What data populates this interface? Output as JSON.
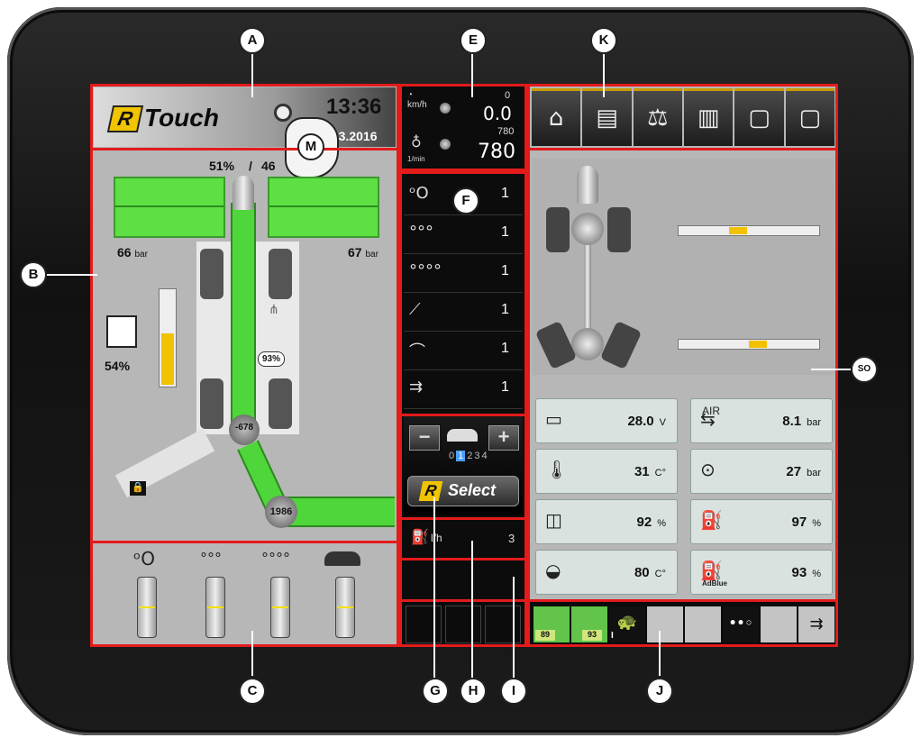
{
  "callouts": {
    "a": "A",
    "b": "B",
    "c": "C",
    "e": "E",
    "f": "F",
    "g": "G",
    "h": "H",
    "i": "I",
    "j": "J",
    "k": "K",
    "m": "M",
    "so": "SO"
  },
  "header": {
    "brand": "Touch",
    "time": "13:36",
    "date": ".03.2016"
  },
  "speed": {
    "unit": "km/h",
    "value": "0.0",
    "small": "0"
  },
  "rpm": {
    "unit": "1/min",
    "value": "780",
    "small": "780"
  },
  "vehicle": {
    "percent_left": "51%",
    "percent_right": "46",
    "pressure_left": "66",
    "pressure_right": "67",
    "pressure_unit": "bar",
    "tank_percent": "54%",
    "tank_level": 0.54,
    "ring_percent": "93%",
    "pivot_value": "-678",
    "roller_value": "1986"
  },
  "menu_items": [
    "1",
    "1",
    "1",
    "1",
    "1",
    "1"
  ],
  "rselect": {
    "brand": "Select",
    "gears": [
      "0",
      "1",
      "2",
      "3",
      "4"
    ]
  },
  "fuel": {
    "unit": "l/h",
    "value": "3"
  },
  "tabs": [
    "home-icon",
    "machine-icon",
    "scale-icon",
    "statistics-icon",
    "page-1-icon",
    "page-2-icon"
  ],
  "status": [
    {
      "icon": "battery-icon",
      "value": "28.0",
      "unit": "V"
    },
    {
      "icon": "air-pressure-icon",
      "label": "AIR",
      "value": "8.1",
      "unit": "bar"
    },
    {
      "icon": "coolant-temp-icon",
      "value": "31",
      "unit": "C°"
    },
    {
      "icon": "brake-pressure-icon",
      "value": "27",
      "unit": "bar"
    },
    {
      "icon": "coolant-level-icon",
      "value": "92",
      "unit": "%"
    },
    {
      "icon": "fuel-level-icon",
      "value": "97",
      "unit": "%"
    },
    {
      "icon": "oil-temp-icon",
      "value": "80",
      "unit": "C°"
    },
    {
      "icon": "adblue-icon",
      "label": "AdBlue",
      "value": "93",
      "unit": "%"
    }
  ],
  "bottom_bar": {
    "left_badge": "89",
    "right_badge": "93",
    "gear_label": "I"
  },
  "levels": [
    0.5,
    0.5,
    0.5,
    0.5
  ]
}
